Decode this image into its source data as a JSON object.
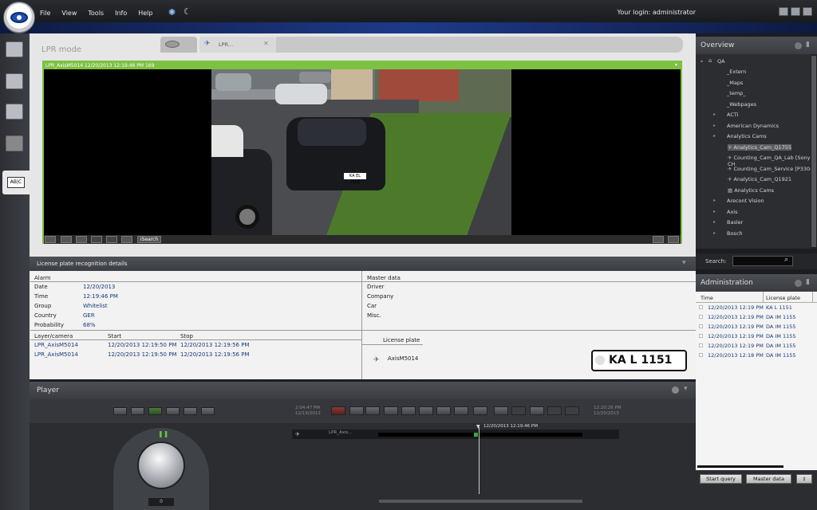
{
  "topbar": {
    "menu": [
      "File",
      "View",
      "Tools",
      "Info",
      "Help"
    ],
    "login": "Your login: administrator"
  },
  "main": {
    "title": "LPR mode",
    "tab_label": "LPR...",
    "video_header": "LPR_AxisM5014 12/20/2013 12:19:46 PM 169",
    "isearch": "iSearch",
    "plate_in_scene": "KA EL 1151"
  },
  "details": {
    "header": "License plate recognition details",
    "alarm_label": "Alarm",
    "fields": [
      {
        "label": "Date",
        "value": "12/20/2013"
      },
      {
        "label": "Time",
        "value": "12:19:46 PM"
      },
      {
        "label": "Group",
        "value": "Whitelist"
      },
      {
        "label": "Country",
        "value": "GER"
      },
      {
        "label": "Probability",
        "value": "68%"
      }
    ],
    "master_label": "Master data",
    "master_fields": [
      "Driver",
      "Company",
      "Car",
      "Misc."
    ],
    "table_headers": [
      "Layer/camera",
      "Start",
      "Stop"
    ],
    "rows": [
      {
        "camera": "LPR_AxisM5014",
        "start": "12/20/2013 12:19:50 PM",
        "stop": "12/20/2013 12:19:56 PM"
      },
      {
        "camera": "LPR_AxisM5014",
        "start": "12/20/2013 12:19:50 PM",
        "stop": "12/20/2013 12:19:56 PM"
      }
    ],
    "plate_label": "License plate",
    "plate_camera": "AxisM5014",
    "plate": "KA L 1151"
  },
  "player": {
    "title": "Player",
    "left_time": "2:04:47 PM",
    "left_date": "12/19/2013",
    "right_time": "12:20:26 PM",
    "right_date": "12/20/2013",
    "track_label": "LPR_Axis...",
    "playhead_label": "12/20/2013 12:19:46 PM",
    "dial_value": "0"
  },
  "overview": {
    "title": "Overview",
    "root": "QA",
    "items": [
      {
        "label": "_Extern",
        "indent": 2,
        "arrow": false
      },
      {
        "label": "_Maps",
        "indent": 2,
        "arrow": false
      },
      {
        "label": "_temp_",
        "indent": 2,
        "arrow": false
      },
      {
        "label": "_Webpages",
        "indent": 2,
        "arrow": false
      },
      {
        "label": "ACTi",
        "indent": 1,
        "arrow": true
      },
      {
        "label": "American Dynamics",
        "indent": 1,
        "arrow": true
      },
      {
        "label": "Analytics Cams",
        "indent": 1,
        "arrow": true
      },
      {
        "label": "Analytics_Cam_Q1755",
        "indent": 3,
        "arrow": false,
        "selected": true
      },
      {
        "label": "Counting_Cam_QA_Lab [Sony CH",
        "indent": 3,
        "arrow": false
      },
      {
        "label": "Counting_Cam_Service [P3304]",
        "indent": 3,
        "arrow": false
      },
      {
        "label": "Analytics_Cam_Q1921",
        "indent": 3,
        "arrow": false
      },
      {
        "label": "Analytics Cams",
        "indent": 3,
        "arrow": false
      },
      {
        "label": "Arecont Vision",
        "indent": 1,
        "arrow": true
      },
      {
        "label": "Axis",
        "indent": 1,
        "arrow": true
      },
      {
        "label": "Basler",
        "indent": 1,
        "arrow": true
      },
      {
        "label": "Bosch",
        "indent": 1,
        "arrow": true
      }
    ],
    "search_label": "Search:"
  },
  "admin": {
    "title": "Administration",
    "headers": [
      "Time",
      "License plate"
    ],
    "rows": [
      {
        "time": "12/20/2013 12:19 PM",
        "plate": "KA L 1151"
      },
      {
        "time": "12/20/2013 12:19 PM",
        "plate": "DA IM 1155"
      },
      {
        "time": "12/20/2013 12:19 PM",
        "plate": "DA IM 1155"
      },
      {
        "time": "12/20/2013 12:19 PM",
        "plate": "DA IM 1155"
      },
      {
        "time": "12/20/2013 12:19 PM",
        "plate": "DA IM 1155"
      },
      {
        "time": "12/20/2013 12:18 PM",
        "plate": "DA IM 1155"
      }
    ],
    "start_query": "Start query",
    "master_data": "Master data"
  }
}
